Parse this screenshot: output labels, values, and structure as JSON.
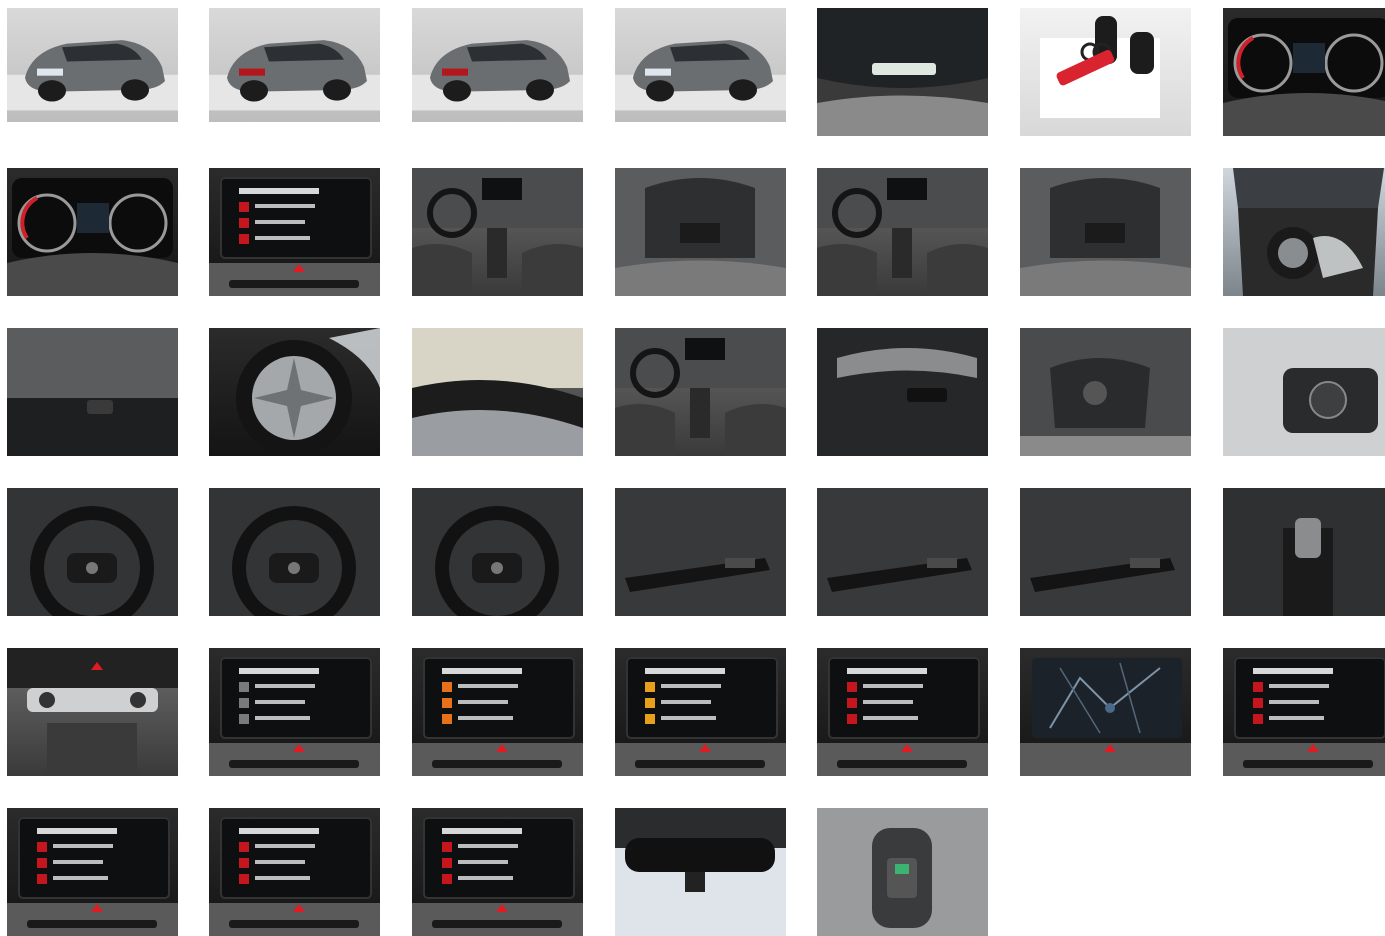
{
  "gallery": {
    "rows": [
      [
        {
          "kind": "car-front-left",
          "scene": "studio"
        },
        {
          "kind": "car-rear",
          "scene": "studio"
        },
        {
          "kind": "car-rear-left",
          "scene": "studio"
        },
        {
          "kind": "car-front-right",
          "scene": "studio"
        },
        {
          "kind": "windshield-vin",
          "scene": "dark"
        },
        {
          "kind": "keys",
          "scene": "white"
        },
        {
          "kind": "instrument-cluster",
          "scene": "dark"
        }
      ],
      [
        {
          "kind": "instrument-cluster-detail",
          "scene": "dark"
        },
        {
          "kind": "infotainment-screen",
          "scene": "dark",
          "accent": "#c4161c"
        },
        {
          "kind": "interior-front",
          "scene": "grey"
        },
        {
          "kind": "rear-seat-door",
          "scene": "grey"
        },
        {
          "kind": "dashboard-overview",
          "scene": "grey"
        },
        {
          "kind": "rear-console",
          "scene": "grey"
        },
        {
          "kind": "trunk-wheels",
          "scene": "garage"
        }
      ],
      [
        {
          "kind": "tailgate-button",
          "scene": "dark"
        },
        {
          "kind": "alloy-wheel",
          "scene": "dark"
        },
        {
          "kind": "tire-closeup",
          "scene": "grey"
        },
        {
          "kind": "interior-front",
          "scene": "grey"
        },
        {
          "kind": "door-panel",
          "scene": "dark"
        },
        {
          "kind": "seat-controls",
          "scene": "grey"
        },
        {
          "kind": "light-switch",
          "scene": "grey"
        }
      ],
      [
        {
          "kind": "steering-wheel-left",
          "scene": "dark"
        },
        {
          "kind": "steering-wheel-right",
          "scene": "dark"
        },
        {
          "kind": "steering-wheel",
          "scene": "grey"
        },
        {
          "kind": "wiper-stalk",
          "scene": "dark"
        },
        {
          "kind": "indicator-stalk",
          "scene": "dark"
        },
        {
          "kind": "cruise-stalk",
          "scene": "dark"
        },
        {
          "kind": "gear-selector",
          "scene": "dark"
        }
      ],
      [
        {
          "kind": "climate-controls",
          "scene": "grey"
        },
        {
          "kind": "infotainment-screen",
          "scene": "dark",
          "accent": "#7a7a7a"
        },
        {
          "kind": "infotainment-screen",
          "scene": "dark",
          "accent": "#e8701a"
        },
        {
          "kind": "infotainment-screen",
          "scene": "dark",
          "accent": "#e8a01a"
        },
        {
          "kind": "infotainment-screen",
          "scene": "dark",
          "accent": "#c4161c"
        },
        {
          "kind": "infotainment-map",
          "scene": "dark",
          "accent": "#4a6a8a"
        },
        {
          "kind": "infotainment-screen",
          "scene": "dark",
          "accent": "#c4161c"
        }
      ],
      [
        {
          "kind": "infotainment-screen",
          "scene": "dark",
          "accent": "#c4161c"
        },
        {
          "kind": "infotainment-screen",
          "scene": "dark",
          "accent": "#c4161c"
        },
        {
          "kind": "infotainment-screen",
          "scene": "dark",
          "accent": "#c4161c"
        },
        {
          "kind": "rearview-mirror",
          "scene": "garage"
        },
        {
          "kind": "overhead-console",
          "scene": "grey",
          "accent": "#3cb371"
        }
      ]
    ]
  }
}
